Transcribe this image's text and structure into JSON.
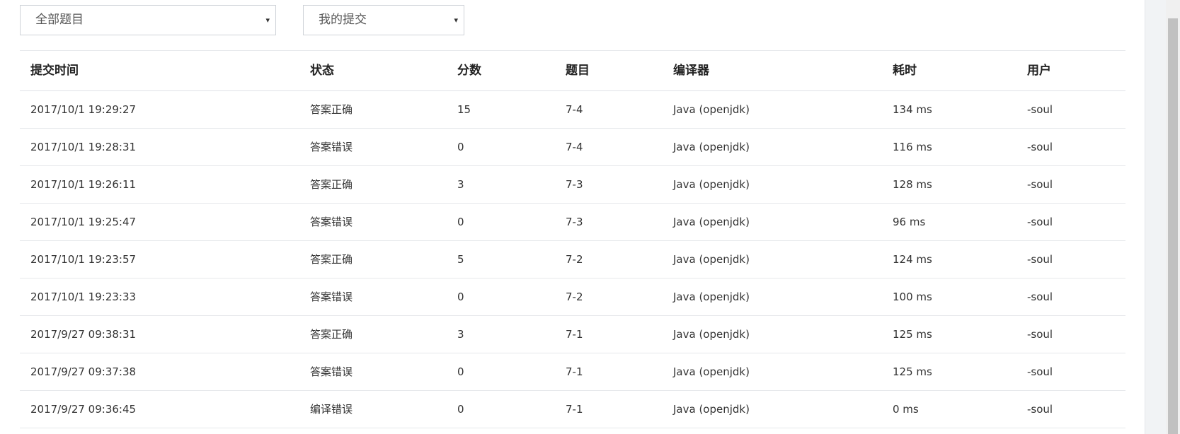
{
  "filters": {
    "problem_select": {
      "value": "全部题目",
      "caret": "▾"
    },
    "submission_select": {
      "value": "我的提交",
      "caret": "▾"
    }
  },
  "table": {
    "headers": {
      "time": "提交时间",
      "status": "状态",
      "score": "分数",
      "problem": "题目",
      "compiler": "编译器",
      "elapsed": "耗时",
      "user": "用户"
    },
    "rows": [
      {
        "time": "2017/10/1 19:29:27",
        "status": "答案正确",
        "status_type": "accepted",
        "score": "15",
        "problem": "7-4",
        "compiler": "Java (openjdk)",
        "elapsed": "134 ms",
        "user": "-soul"
      },
      {
        "time": "2017/10/1 19:28:31",
        "status": "答案错误",
        "status_type": "wrong",
        "score": "0",
        "problem": "7-4",
        "compiler": "Java (openjdk)",
        "elapsed": "116 ms",
        "user": "-soul"
      },
      {
        "time": "2017/10/1 19:26:11",
        "status": "答案正确",
        "status_type": "accepted",
        "score": "3",
        "problem": "7-3",
        "compiler": "Java (openjdk)",
        "elapsed": "128 ms",
        "user": "-soul"
      },
      {
        "time": "2017/10/1 19:25:47",
        "status": "答案错误",
        "status_type": "wrong",
        "score": "0",
        "problem": "7-3",
        "compiler": "Java (openjdk)",
        "elapsed": "96 ms",
        "user": "-soul"
      },
      {
        "time": "2017/10/1 19:23:57",
        "status": "答案正确",
        "status_type": "accepted",
        "score": "5",
        "problem": "7-2",
        "compiler": "Java (openjdk)",
        "elapsed": "124 ms",
        "user": "-soul"
      },
      {
        "time": "2017/10/1 19:23:33",
        "status": "答案错误",
        "status_type": "wrong",
        "score": "0",
        "problem": "7-2",
        "compiler": "Java (openjdk)",
        "elapsed": "100 ms",
        "user": "-soul"
      },
      {
        "time": "2017/9/27 09:38:31",
        "status": "答案正确",
        "status_type": "accepted",
        "score": "3",
        "problem": "7-1",
        "compiler": "Java (openjdk)",
        "elapsed": "125 ms",
        "user": "-soul"
      },
      {
        "time": "2017/9/27 09:37:38",
        "status": "答案错误",
        "status_type": "wrong",
        "score": "0",
        "problem": "7-1",
        "compiler": "Java (openjdk)",
        "elapsed": "125 ms",
        "user": "-soul"
      },
      {
        "time": "2017/9/27 09:36:45",
        "status": "编译错误",
        "status_type": "compile_error",
        "score": "0",
        "problem": "7-1",
        "compiler": "Java (openjdk)",
        "elapsed": "0 ms",
        "user": "-soul"
      }
    ]
  },
  "colors": {
    "accepted": "#e5322d",
    "wrong": "#3cab4a",
    "compile_error": "#1e88d8",
    "link": "#1f4f86"
  }
}
